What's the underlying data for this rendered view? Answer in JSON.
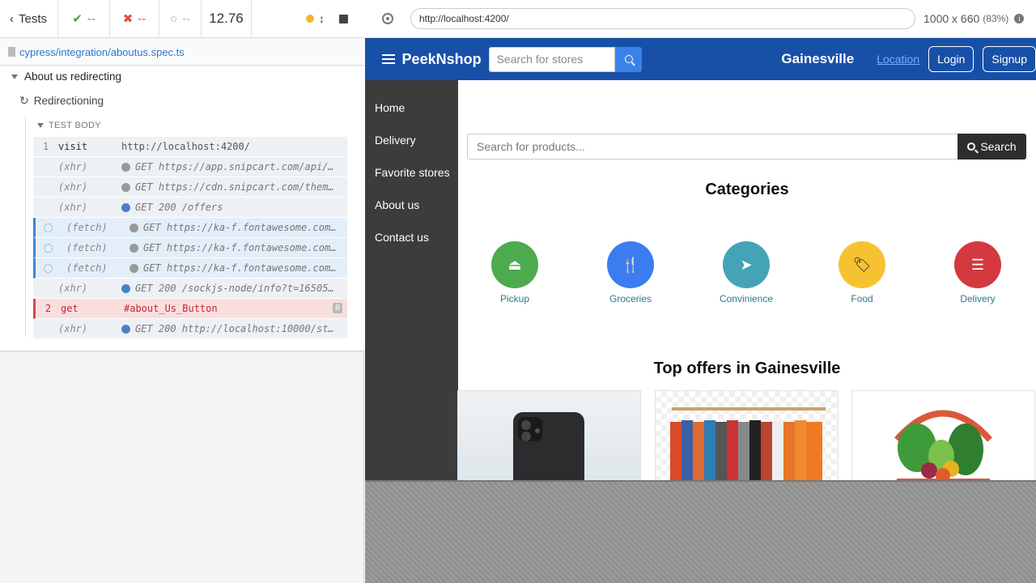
{
  "runner": {
    "tests_label": "Tests",
    "passed": "--",
    "failed": "--",
    "pending": "--",
    "duration": "12.76",
    "spec_path": "cypress/integration/aboutus.spec.ts",
    "suite_title": "About us redirecting",
    "test_title": "Redirectioning",
    "test_body_label": "TEST BODY",
    "commands": [
      {
        "num": "1",
        "name": "visit",
        "msg": "http://localhost:4200/",
        "kind": "plain",
        "dot": ""
      },
      {
        "num": "",
        "name": "(xhr)",
        "msg": "GET https://app.snipcart.com/api/…",
        "kind": "xhr",
        "dot": "gray"
      },
      {
        "num": "",
        "name": "(xhr)",
        "msg": "GET https://cdn.snipcart.com/them…",
        "kind": "xhr",
        "dot": "gray"
      },
      {
        "num": "",
        "name": "(xhr)",
        "msg": "GET 200 /offers",
        "kind": "xhr",
        "dot": "blue"
      },
      {
        "num": "",
        "name": "(fetch)",
        "msg": "GET https://ka-f.fontawesome.com/…",
        "kind": "pending",
        "dot": "gray"
      },
      {
        "num": "",
        "name": "(fetch)",
        "msg": "GET https://ka-f.fontawesome.com/…",
        "kind": "pending",
        "dot": "gray"
      },
      {
        "num": "",
        "name": "(fetch)",
        "msg": "GET https://ka-f.fontawesome.com/…",
        "kind": "pending",
        "dot": "gray"
      },
      {
        "num": "",
        "name": "(xhr)",
        "msg": "GET 200 /sockjs-node/info?t=16505…",
        "kind": "xhr",
        "dot": "blue"
      },
      {
        "num": "2",
        "name": "get",
        "msg": "#about_Us_Button",
        "kind": "failed",
        "dot": "",
        "badge": "0"
      },
      {
        "num": "",
        "name": "(xhr)",
        "msg": "GET 200 http://localhost:10000/st…",
        "kind": "xhr",
        "dot": "blue"
      }
    ]
  },
  "aut": {
    "url": "http://localhost:4200/",
    "viewport": "1000 x 660",
    "zoom": "(83%)"
  },
  "site": {
    "brand": "PeekNshop",
    "store_search_placeholder": "Search for stores",
    "city": "Gainesville",
    "location_link": "Location",
    "login": "Login",
    "signup": "Signup",
    "sidebar": [
      "Home",
      "Delivery",
      "Favorite stores",
      "About us",
      "Contact us"
    ],
    "product_search_placeholder": "Search for products...",
    "search_button": "Search",
    "categories_title": "Categories",
    "categories": [
      {
        "label": "Pickup",
        "color": "#4caa4f",
        "icon": "⏏"
      },
      {
        "label": "Groceries",
        "color": "#3b7cf0",
        "icon": "🍴"
      },
      {
        "label": "Convinience",
        "color": "#45a3b8",
        "icon": "➤"
      },
      {
        "label": "Food",
        "color": "#f7c232",
        "icon": "🏷"
      },
      {
        "label": "Delivery",
        "color": "#d4393f",
        "icon": "☰"
      }
    ],
    "offers_title": "Top offers in Gainesville"
  }
}
